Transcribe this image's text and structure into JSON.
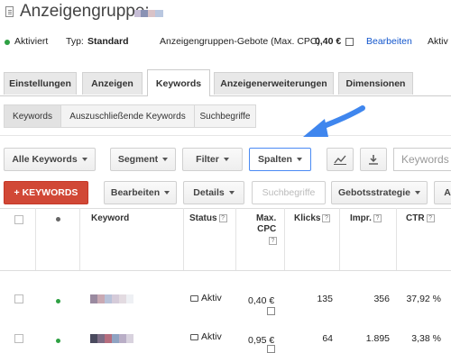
{
  "header": {
    "title": "Anzeigengruppe:",
    "status": "Aktiviert",
    "type_label": "Typ:",
    "type_value": "Standard",
    "bids_label": "Anzeigengruppen-Gebote (Max. CPC)",
    "bids_value": "0,40 €",
    "edit_link": "Bearbeiten",
    "truncated_label": "Aktiv"
  },
  "tabs": [
    "Einstellungen",
    "Anzeigen",
    "Keywords",
    "Anzeigenerweiterungen",
    "Dimensionen"
  ],
  "active_tab": "Keywords",
  "subtabs": [
    "Keywords",
    "Auszuschließende Keywords",
    "Suchbegriffe"
  ],
  "toolbar1": {
    "all_keywords": "Alle Keywords",
    "segment": "Segment",
    "filter": "Filter",
    "columns": "Spalten",
    "search_placeholder": "Keywords"
  },
  "toolbar2": {
    "add_keywords": "+ KEYWORDS",
    "edit": "Bearbeiten",
    "details": "Details",
    "search_terms": "Suchbegriffe",
    "bid_strategy": "Gebotsstrategie",
    "truncated": "A"
  },
  "table": {
    "headers": {
      "keyword": "Keyword",
      "status": "Status",
      "max_cpc_line1": "Max.",
      "max_cpc_line2": "CPC",
      "clicks": "Klicks",
      "impressions": "Impr.",
      "ctr": "CTR"
    },
    "help_glyph": "?",
    "rows": [
      {
        "status": "Aktiv",
        "max_cpc": "0,40 €",
        "clicks": "135",
        "impressions": "356",
        "ctr": "37,92 %"
      },
      {
        "status": "Aktiv",
        "max_cpc": "0,95 €",
        "clicks": "64",
        "impressions": "1.895",
        "ctr": "3,38 %"
      }
    ]
  },
  "colors": {
    "accent_blue": "#4a8af4",
    "link_blue": "#1155cc",
    "add_button_red": "#d14836",
    "active_green": "#2ea043"
  },
  "icons": [
    "ad-group-icon",
    "edit-icon",
    "chart-icon",
    "download-icon",
    "speech-bubble-icon",
    "help-icon",
    "blue-arrow-pointer"
  ]
}
